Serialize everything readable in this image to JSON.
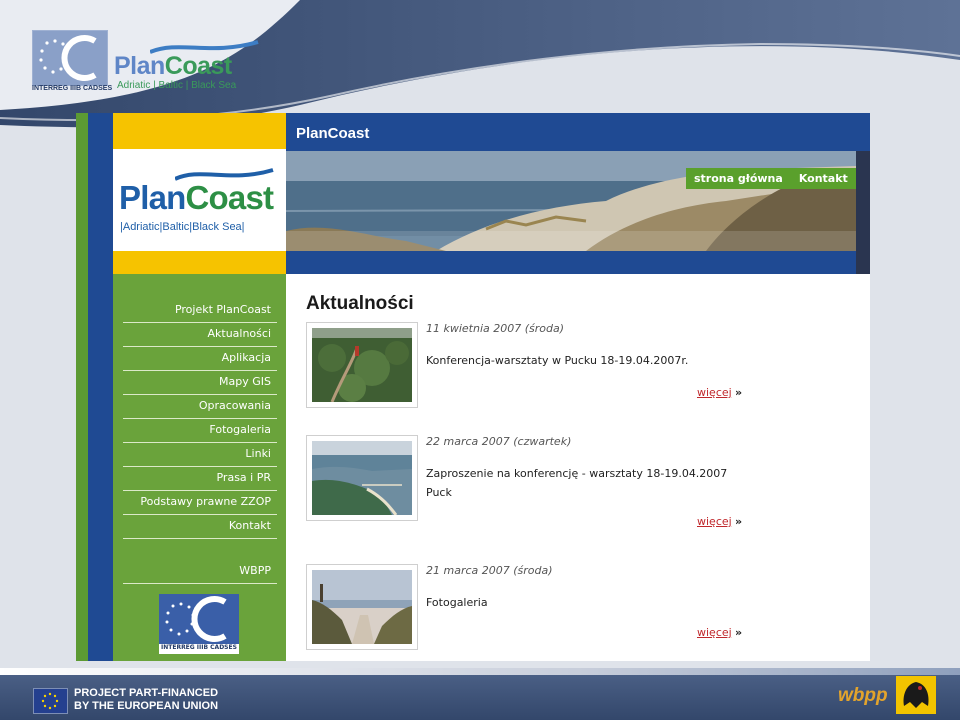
{
  "slide": {
    "eu_logo_caption": "INTERREG IIIB  CADSES",
    "plancoast_plan": "Plan",
    "plancoast_coast": "Coast",
    "plancoast_sub": "Adriatic | Baltic | Black Sea",
    "footer_line1": "PROJECT PART-FINANCED",
    "footer_line2": "BY THE EUROPEAN UNION",
    "wbpp": "wbpp"
  },
  "site": {
    "header_title": "PlanCoast",
    "logo_plan": "Plan",
    "logo_coast": "Coast",
    "logo_sub": "|Adriatic|Baltic|Black Sea|",
    "top_links": [
      "strona główna",
      "Kontakt"
    ],
    "nav": [
      "Projekt PlanCoast",
      "Aktualności",
      "Aplikacja",
      "Mapy GIS",
      "Opracowania",
      "Fotogaleria",
      "Linki",
      "Prasa i PR",
      "Podstawy prawne ZZOP",
      "Kontakt"
    ],
    "nav_extra": "WBPP",
    "nav_logo_caption": "INTERREG IIIB CADSES",
    "content_title": "Aktualności",
    "news": [
      {
        "date": "11 kwietnia 2007 (środa)",
        "text": "Konferencja-warsztaty w Pucku 18-19.04.2007r.",
        "more": "więcej",
        "arrow": "»",
        "thumb": "forest"
      },
      {
        "date": "22 marca 2007 (czwartek)",
        "text": "Zaproszenie na konferencję - warsztaty 18-19.04.2007 Puck",
        "more": "więcej",
        "arrow": "»",
        "thumb": "coast"
      },
      {
        "date": "21 marca 2007 (środa)",
        "text": "Fotogaleria",
        "more": "więcej",
        "arrow": "»",
        "thumb": "beach"
      }
    ]
  },
  "colors": {
    "site_blue": "#1f4a93",
    "site_green": "#6aa33b",
    "site_yellow": "#f6c300",
    "link_red": "#c0282c"
  }
}
